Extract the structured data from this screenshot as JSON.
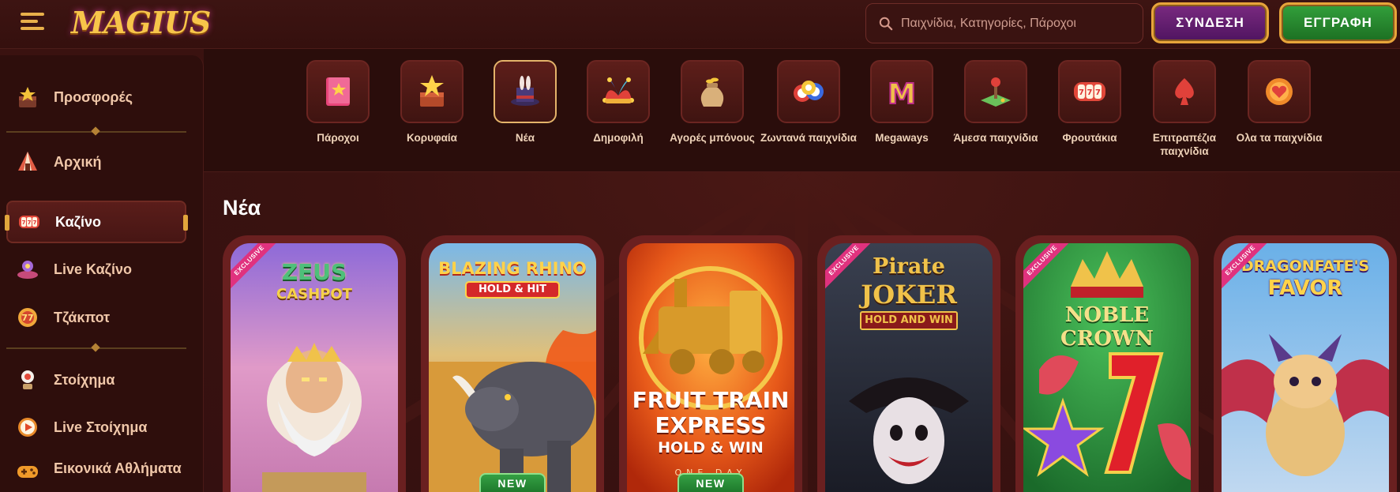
{
  "header": {
    "logo": "MAGIUS",
    "search_placeholder": "Παιχνίδια, Κατηγορίες, Πάροχοι",
    "login_label": "ΣΥΝΔΕΣΗ",
    "register_label": "ΕΓΓΡΑΦΗ"
  },
  "sidebar": {
    "items": [
      {
        "label": "Προσφορές",
        "icon": "gift-box-icon"
      },
      {
        "label": "Αρχική",
        "icon": "tent-icon"
      },
      {
        "label": "Καζίνο",
        "icon": "slot-reels-icon"
      },
      {
        "label": "Live Καζίνο",
        "icon": "live-dealer-icon"
      },
      {
        "label": "Τζάκποτ",
        "icon": "jackpot-777-icon"
      },
      {
        "label": "Στοίχημα",
        "icon": "trophy-icon"
      },
      {
        "label": "Live Στοίχημα",
        "icon": "live-play-icon"
      },
      {
        "label": "Εικονικά Αθλήματα",
        "icon": "gamepad-icon"
      }
    ]
  },
  "categories": [
    {
      "label": "Πάροχοι",
      "icon": "book-icon"
    },
    {
      "label": "Κορυφαία",
      "icon": "star-box-icon"
    },
    {
      "label": "Νέα",
      "icon": "magic-hat-icon",
      "selected": true
    },
    {
      "label": "Δημοφιλή",
      "icon": "jester-hat-icon"
    },
    {
      "label": "Αγορές μπόνους",
      "icon": "money-bag-icon"
    },
    {
      "label": "Ζωντανά παιχνίδια",
      "icon": "casino-chips-icon"
    },
    {
      "label": "Megaways",
      "icon": "megaways-m-icon"
    },
    {
      "label": "Άμεσα παιχνίδια",
      "icon": "joystick-icon"
    },
    {
      "label": "Φρουτάκια",
      "icon": "slot-reels-icon"
    },
    {
      "label": "Επιτραπέζια παιχνίδια",
      "icon": "spade-card-icon"
    },
    {
      "label": "Ολα τα παιχνίδια",
      "icon": "heart-chip-icon"
    }
  ],
  "section": {
    "title": "Νέα"
  },
  "games": [
    {
      "title_line1": "ZEUS",
      "title_line2": "CASHPOT",
      "exclusive": "EXCLUSIVE",
      "badge": ""
    },
    {
      "title_line1": "BLAZING RHINO",
      "title_line2": "HOLD & HIT",
      "exclusive": "",
      "badge": "NEW"
    },
    {
      "title_line1": "FRUIT TRAIN",
      "title_line2": "EXPRESS",
      "title_line3": "HOLD & WIN",
      "exclusive": "",
      "badge": "NEW",
      "sub": "ONE DAY"
    },
    {
      "title_line1": "Pirate",
      "title_line2": "JOKER",
      "title_line3": "HOLD AND WIN",
      "exclusive": "EXCLUSIVE",
      "badge": ""
    },
    {
      "title_line1": "NOBLE",
      "title_line2": "CROWN",
      "exclusive": "EXCLUSIVE",
      "badge": ""
    },
    {
      "title_line1": "DRAGONFATE'S",
      "title_line2": "FAVOR",
      "exclusive": "EXCLUSIVE",
      "badge": ""
    }
  ]
}
